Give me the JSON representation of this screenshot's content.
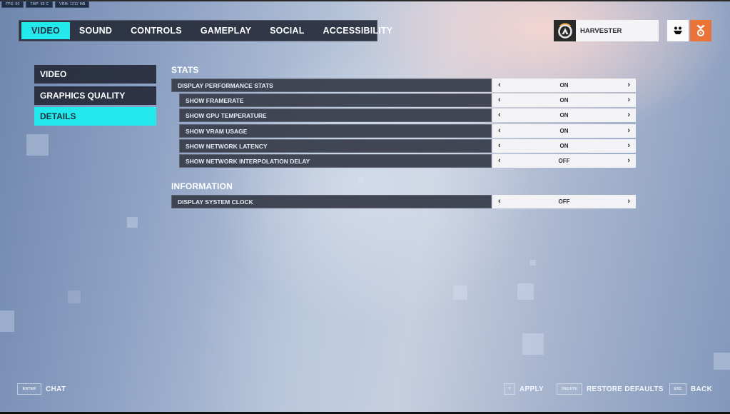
{
  "perf_overlay": {
    "fps": "FPS: 60",
    "temp": "TMP: 65 C",
    "vram": "VRM: 1212 MB"
  },
  "top_nav": {
    "tabs": [
      {
        "label": "VIDEO",
        "active": true
      },
      {
        "label": "SOUND",
        "active": false
      },
      {
        "label": "CONTROLS",
        "active": false
      },
      {
        "label": "GAMEPLAY",
        "active": false
      },
      {
        "label": "SOCIAL",
        "active": false
      },
      {
        "label": "ACCESSIBILITY",
        "active": false
      }
    ]
  },
  "profile": {
    "name": "HARVESTER",
    "logo_icon": "overwatch-logo-icon",
    "social_icon": "social-group-icon",
    "reward_icon": "reward-medal-icon"
  },
  "side_menu": {
    "items": [
      {
        "label": "VIDEO",
        "active": false
      },
      {
        "label": "GRAPHICS QUALITY",
        "active": false
      },
      {
        "label": "DETAILS",
        "active": true
      }
    ]
  },
  "sections": [
    {
      "title": "STATS",
      "settings": [
        {
          "label": "DISPLAY PERFORMANCE STATS",
          "value": "ON",
          "indent": false
        },
        {
          "label": "SHOW FRAMERATE",
          "value": "ON",
          "indent": true
        },
        {
          "label": "SHOW GPU TEMPERATURE",
          "value": "ON",
          "indent": true
        },
        {
          "label": "SHOW VRAM USAGE",
          "value": "ON",
          "indent": true
        },
        {
          "label": "SHOW NETWORK LATENCY",
          "value": "ON",
          "indent": true
        },
        {
          "label": "SHOW NETWORK INTERPOLATION DELAY",
          "value": "OFF",
          "indent": true
        }
      ]
    },
    {
      "title": "INFORMATION",
      "settings": [
        {
          "label": "DISPLAY SYSTEM CLOCK",
          "value": "OFF",
          "indent": false
        }
      ]
    }
  ],
  "controls": {
    "prev_glyph": "‹",
    "next_glyph": "›"
  },
  "bottom_bar": {
    "chat": {
      "key": "ENTER",
      "label": "CHAT"
    },
    "apply": {
      "key": "Y",
      "label": "APPLY"
    },
    "restore": {
      "key": "DELETE",
      "label": "RESTORE DEFAULTS"
    },
    "back": {
      "key": "ESC",
      "label": "BACK"
    }
  },
  "colors": {
    "accent": "#23e8ec",
    "reward": "#ea7437",
    "panel": "#262b3a"
  }
}
